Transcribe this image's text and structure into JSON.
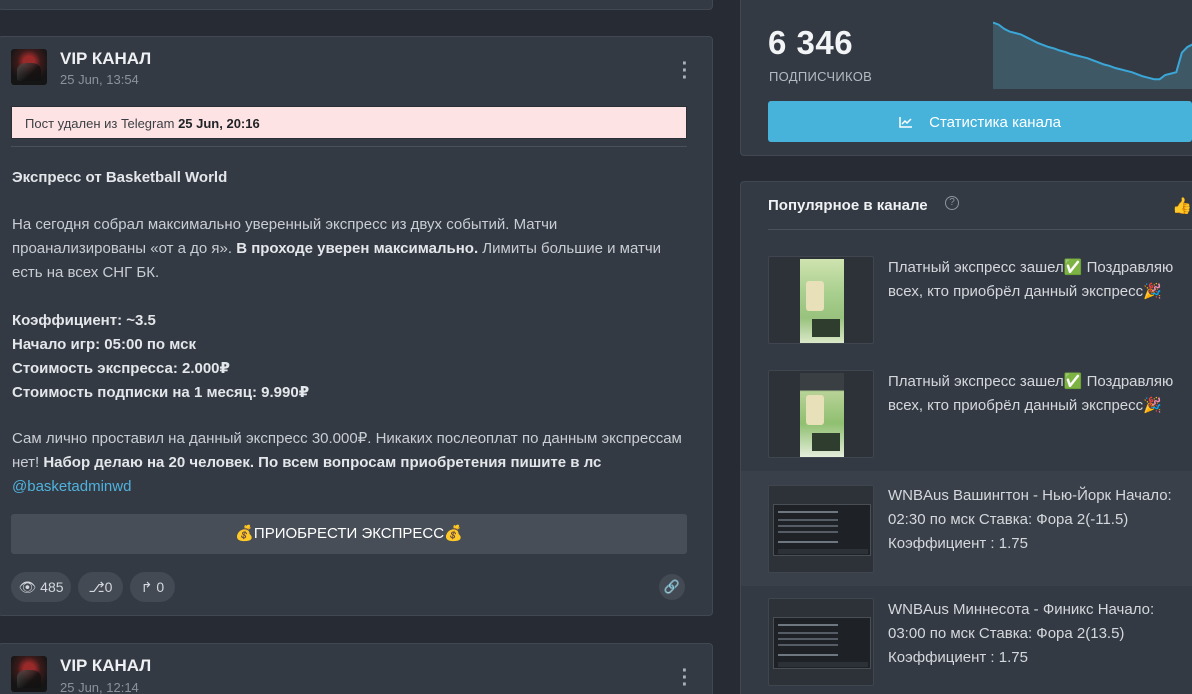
{
  "posts": [
    {
      "channel_name": "VIP КАНАЛ",
      "date": "25 Jun, 13:54",
      "deleted_prefix": "Пост удален из Telegram",
      "deleted_date": "25 Jun, 20:16",
      "title": "Экспресс от Basketball World",
      "p1_start": "На сегодня собрал максимально уверенный экспресс из двух событий. Матчи проанализированы «от а до я».",
      "p1_bold": "В проходе уверен максимально.",
      "p1_end": "Лимиты большие и матчи есть на всех СНГ БК.",
      "coef": "Коэффициент: ~3.5",
      "start": "Начало игр: 05:00 по мск",
      "price": "Стоимость экспресса: 2.000₽",
      "sub_price": "Стоимость подписки на 1 месяц: 9.990₽",
      "p3_start": "Сам лично проставил на данный экспресс 30.000₽. Никаких послеоплат по данным экспрессам нет!",
      "p3_bold": "Набор делаю на 20 человек. По всем вопросам приобретения пишите в лс",
      "mention": "@basketadminwd",
      "button_label": "💰ПРИОБРЕСТИ ЭКСПРЕСС💰",
      "views": "485",
      "shares": "0",
      "forwards": "0"
    },
    {
      "channel_name": "VIP КАНАЛ",
      "date": "25 Jun, 12:14"
    }
  ],
  "stats": {
    "subscribers": "6 346",
    "subscribers_label": "ПОДПИСЧИКОВ",
    "button_label": "Статистика канала",
    "sparkline": [
      95,
      92,
      86,
      82,
      80,
      78,
      74,
      70,
      66,
      63,
      60,
      58,
      55,
      53,
      50,
      48,
      46,
      44,
      41,
      38,
      35,
      33,
      30,
      28,
      26,
      24,
      21,
      18,
      16,
      14,
      14,
      20,
      22,
      24,
      52,
      60,
      64
    ]
  },
  "popular": {
    "title": "Популярное в канале",
    "help_icon": "question-circle-icon",
    "like_icon": "thumbs-up-icon",
    "items": [
      {
        "line1": "Платный экспресс зашел✅ Поздравляю",
        "line2": "всех, кто приобрёл данный экспресс🎉",
        "line3": ""
      },
      {
        "line1": "Платный экспресс зашел✅ Поздравляю",
        "line2": "всех, кто приобрёл данный экспресс🎉",
        "line3": ""
      },
      {
        "line1": "WNBAus Вашингтон - Нью-Йорк Начало:",
        "line2": "02:30 по мск Ставка: Фора 2(-11.5)",
        "line3": "Коэффициент : 1.75"
      },
      {
        "line1": "WNBAus Миннесота - Финикс Начало:",
        "line2": "03:00 по мск Ставка: Фора 2(13.5)",
        "line3": "Коэффициент : 1.75"
      }
    ]
  }
}
